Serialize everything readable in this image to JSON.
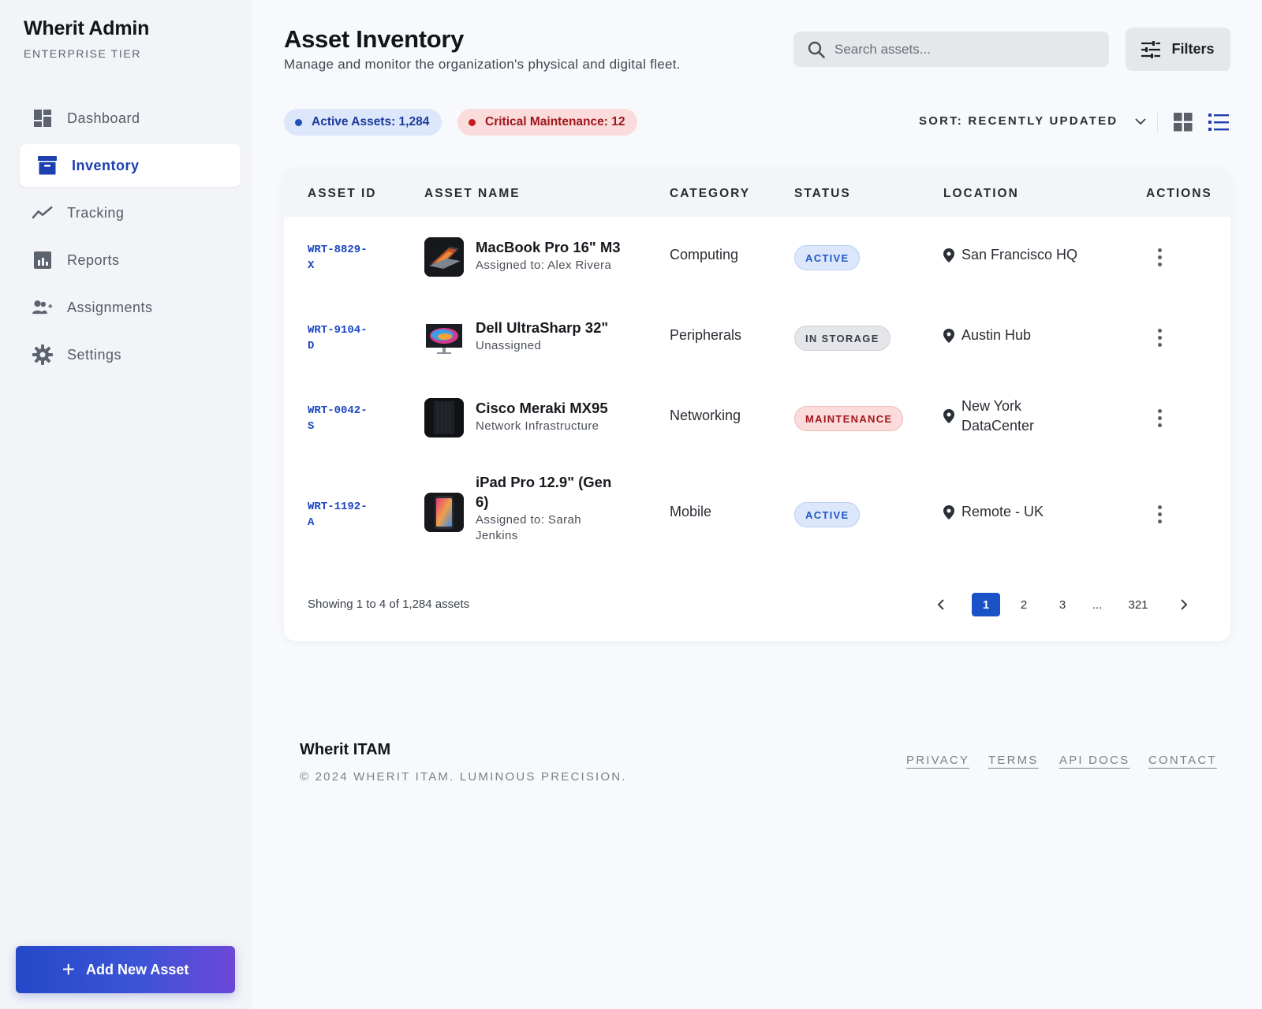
{
  "brand": {
    "title": "Wherit Admin",
    "tier": "ENTERPRISE TIER"
  },
  "sidebar": {
    "items": [
      {
        "label": "Dashboard",
        "icon": "dashboard-icon",
        "active": false
      },
      {
        "label": "Inventory",
        "icon": "archive-icon",
        "active": true
      },
      {
        "label": "Tracking",
        "icon": "trend-line-icon",
        "active": false
      },
      {
        "label": "Reports",
        "icon": "bar-chart-icon",
        "active": false
      },
      {
        "label": "Assignments",
        "icon": "person-add-icon",
        "active": false
      },
      {
        "label": "Settings",
        "icon": "gear-icon",
        "active": false
      }
    ],
    "add_button": "Add New Asset"
  },
  "header": {
    "title": "Asset Inventory",
    "subtitle": "Manage and monitor the organization's physical and digital fleet.",
    "search_placeholder": "Search assets...",
    "filters_label": "Filters"
  },
  "summary": {
    "active": "Active Assets: 1,284",
    "critical": "Critical Maintenance: 12"
  },
  "sort": {
    "label": "SORT: RECENTLY UPDATED"
  },
  "table": {
    "columns": [
      "ASSET ID",
      "ASSET NAME",
      "CATEGORY",
      "STATUS",
      "LOCATION",
      "ACTIONS"
    ],
    "rows": [
      {
        "id_line1": "WRT-8829-",
        "id_line2": "X",
        "name": "MacBook Pro 16\" M3",
        "sub": "Assigned to: Alex Rivera",
        "category": "Computing",
        "status": "ACTIVE",
        "location": "San Francisco HQ",
        "thumb": "laptop"
      },
      {
        "id_line1": "WRT-9104-",
        "id_line2": "D",
        "name": "Dell UltraSharp 32\"",
        "sub": "Unassigned",
        "category": "Peripherals",
        "status": "IN STORAGE",
        "location": "Austin Hub",
        "thumb": "monitor"
      },
      {
        "id_line1": "WRT-0042-",
        "id_line2": "S",
        "name": "Cisco Meraki MX95",
        "sub": "Network Infrastructure",
        "category": "Networking",
        "status": "MAINTENANCE",
        "location_line1": "New York",
        "location_line2": "DataCenter",
        "thumb": "server"
      },
      {
        "id_line1": "WRT-1192-",
        "id_line2": "A",
        "name_line1": "iPad Pro 12.9\" (Gen",
        "name_line2": "6)",
        "sub_line1": "Assigned to: Sarah",
        "sub_line2": "Jenkins",
        "category": "Mobile",
        "status": "ACTIVE",
        "location": "Remote - UK",
        "thumb": "tablet"
      }
    ],
    "showing": "Showing 1 to 4 of 1,284 assets",
    "pages": [
      "1",
      "2",
      "3",
      "...",
      "321"
    ],
    "current_page": "1"
  },
  "footer": {
    "brand": "Wherit ITAM",
    "copyright": "© 2024 WHERIT ITAM. LUMINOUS PRECISION.",
    "links": [
      "PRIVACY",
      "TERMS",
      "API DOCS",
      "CONTACT"
    ]
  },
  "colors": {
    "accent": "#1d3fb0",
    "active_badge": "#1f58c7",
    "maintenance_badge": "#a5161c",
    "add_button_gradient": [
      "#2449c8",
      "#6c48d8"
    ]
  }
}
